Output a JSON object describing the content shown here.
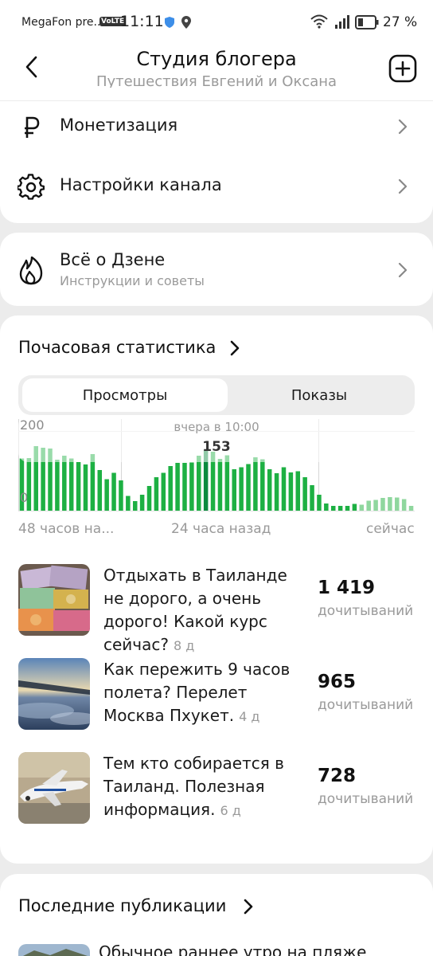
{
  "status_bar": {
    "carrier": "MegaFon pre...",
    "volte": "VoLTE",
    "time": "11:11",
    "battery": "27 %"
  },
  "header": {
    "title": "Студия блогера",
    "subtitle": "Путешествия Евгений и Оксана"
  },
  "menu": [
    {
      "label": "Монетизация",
      "icon": "ruble-icon"
    },
    {
      "label": "Настройки канала",
      "icon": "gear-icon"
    }
  ],
  "dzen": {
    "label": "Всё о Дзене",
    "sub": "Инструкции и советы",
    "icon": "flame-icon"
  },
  "hourly": {
    "title": "Почасовая статистика",
    "tabs": [
      "Просмотры",
      "Показы"
    ],
    "active_tab": "Просмотры"
  },
  "chart_data": {
    "type": "bar",
    "ylim": [
      0,
      200
    ],
    "y_ticks": [
      "200",
      "0"
    ],
    "tooltip_label": "вчера в 10:00",
    "tooltip_value": "153",
    "x_labels": [
      "48 часов на...",
      "24 часа назад",
      "сейчас"
    ],
    "values": [
      131,
      132,
      162,
      158,
      156,
      128,
      138,
      131,
      122,
      116,
      142,
      102,
      79,
      95,
      76,
      37,
      24,
      40,
      62,
      84,
      95,
      112,
      120,
      120,
      121,
      138,
      153,
      148,
      130,
      139,
      104,
      109,
      117,
      134,
      129,
      104,
      94,
      109,
      96,
      99,
      84,
      64,
      40,
      18,
      12,
      12,
      12,
      17,
      15,
      25,
      27,
      32,
      34,
      33,
      29,
      12
    ],
    "highlight_index": 26,
    "current_from_index": 48,
    "colors": {
      "bar": "#1db043",
      "highlight": "#0b8a3e",
      "current": "#8fd79e"
    }
  },
  "articles": [
    {
      "title": "Отдыхать в Таиланде не дорого, а очень дорого! Какой курс сейчас?",
      "age": "8 д",
      "count": "1 419",
      "unit": "дочитываний"
    },
    {
      "title": "Как пережить 9 часов полета? Перелет Москва Пхукет.",
      "age": "4 д",
      "count": "965",
      "unit": "дочитываний"
    },
    {
      "title": "Тем кто собирается в Таиланд. Полезная информация.",
      "age": "6 д",
      "count": "728",
      "unit": "дочитываний"
    }
  ],
  "latest": {
    "title": "Последние публикации",
    "first_item": "Обычное раннее утро на пляже"
  }
}
